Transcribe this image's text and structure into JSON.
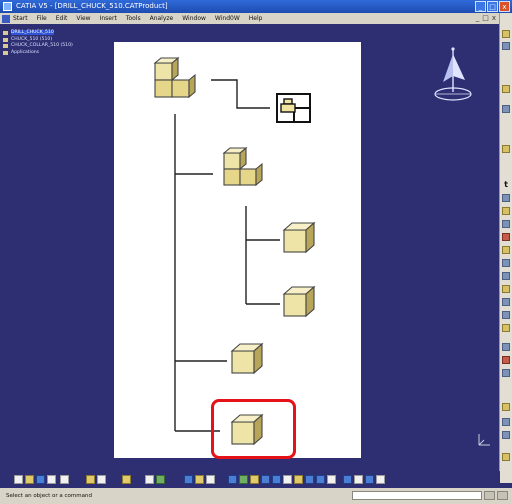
{
  "window": {
    "title": "CATIA V5 - [DRILL_CHUCK_510.CATProduct]",
    "controls": {
      "minimize": "_",
      "maximize": "□",
      "close": "x"
    }
  },
  "menubar": {
    "items": [
      "Start",
      "File",
      "Edit",
      "View",
      "Insert",
      "Tools",
      "Analyze",
      "Window",
      "Wind0W",
      "Help"
    ],
    "right_controls": [
      "_",
      "□",
      "x"
    ]
  },
  "spec_tree": {
    "items": [
      {
        "label": "DRILL_CHUCK_510",
        "selected": true
      },
      {
        "label": "CHUCK_510 (510)",
        "selected": false
      },
      {
        "label": "CHUCK_COLLAR_510 (510)",
        "selected": false
      },
      {
        "label": "Applications",
        "selected": false
      }
    ]
  },
  "status": {
    "prompt": "Select an object or a command",
    "command_value": ""
  },
  "colors": {
    "background": "#2d2f72",
    "highlight": "#e5121a",
    "part_fill": "#efe4a8",
    "part_stroke": "#3b3b3b"
  },
  "icons": {
    "assembly_root": "product-assembly-icon",
    "drawing": "drawing-sheet-icon",
    "sub_assembly": "product-assembly-icon",
    "parts": "part-cube-icon",
    "compass": "compass-icon",
    "axis": "axis-system-icon"
  }
}
